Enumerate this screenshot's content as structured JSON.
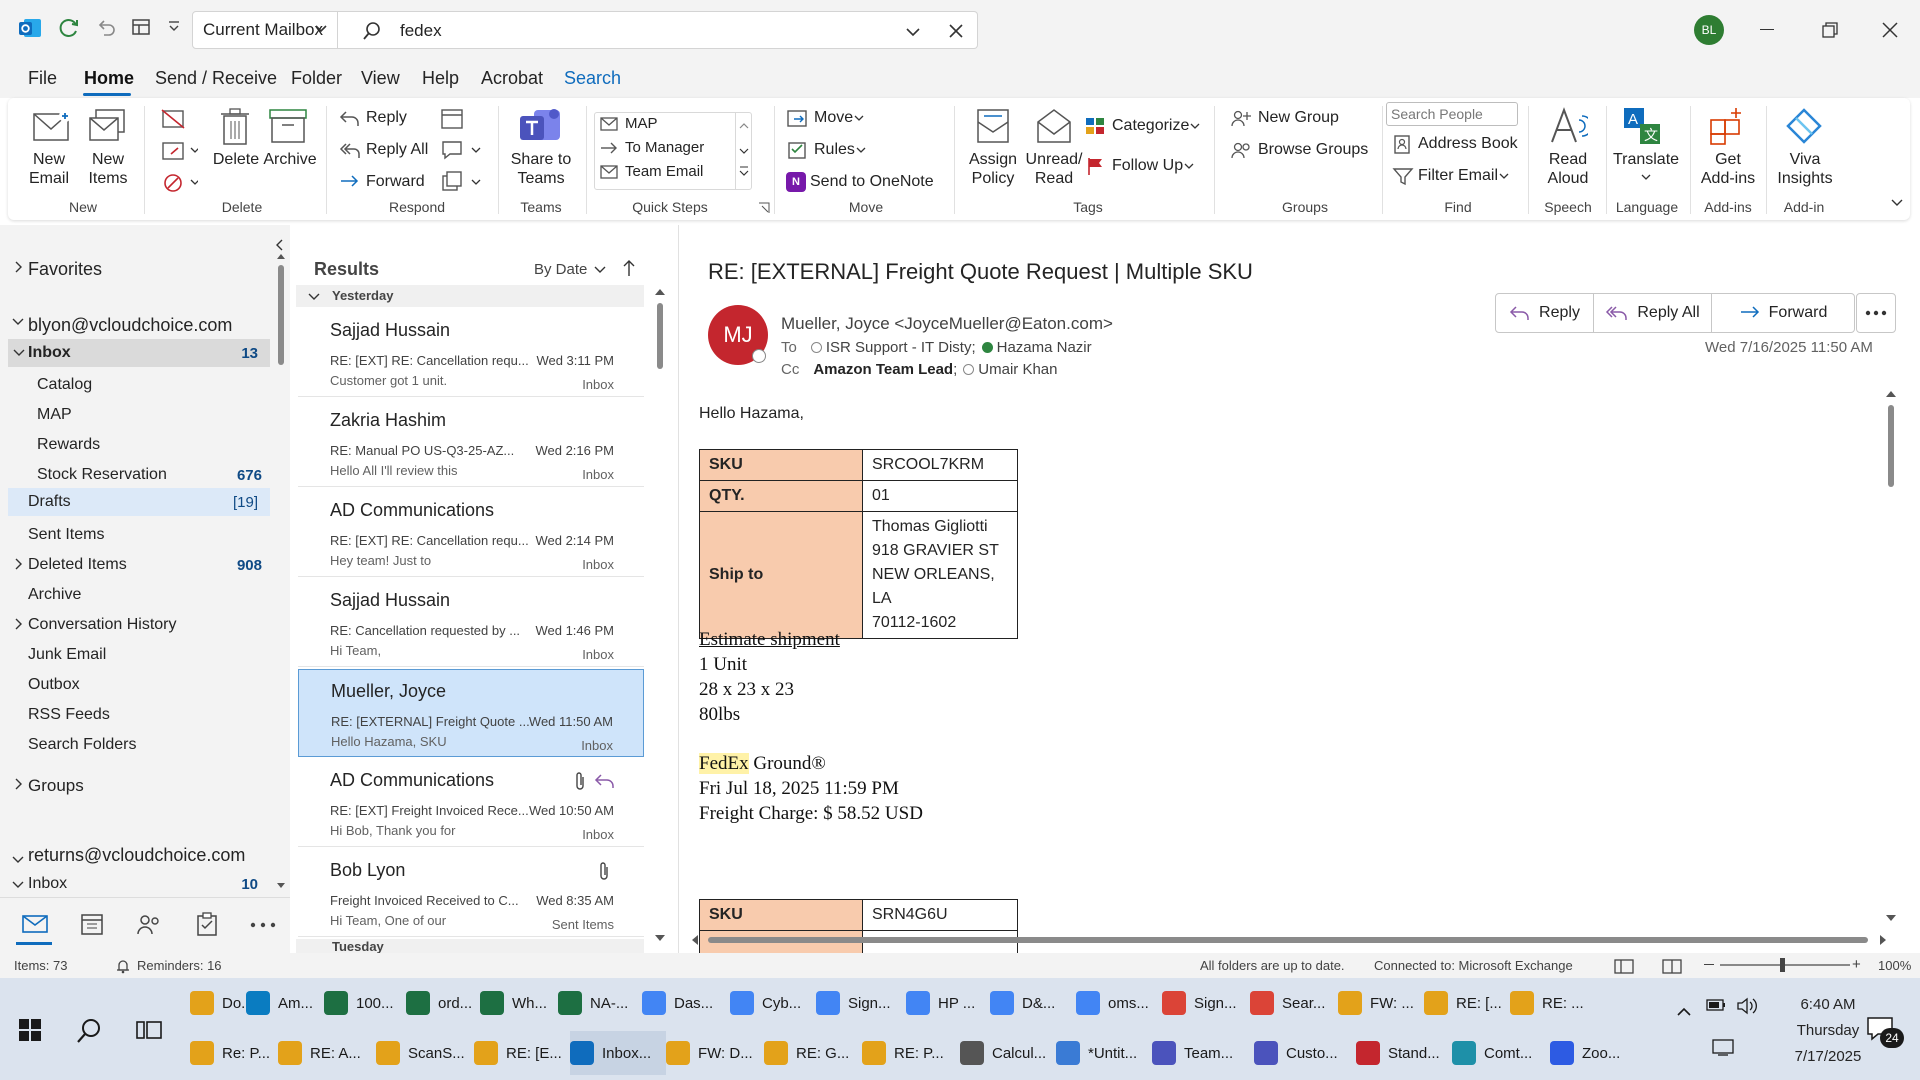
{
  "titlebar": {
    "scope": "Current Mailbox",
    "search_value": "fedex",
    "avatar": "BL"
  },
  "menu": {
    "file": "File",
    "home": "Home",
    "send_receive": "Send / Receive",
    "folder": "Folder",
    "view": "View",
    "help": "Help",
    "acrobat": "Acrobat",
    "search": "Search"
  },
  "ribbon": {
    "new_email": [
      "New",
      "Email"
    ],
    "new_items": [
      "New",
      "Items"
    ],
    "delete": "Delete",
    "archive": "Archive",
    "reply": "Reply",
    "reply_all": "Reply All",
    "forward": "Forward",
    "share_to_teams": [
      "Share to",
      "Teams"
    ],
    "quick_steps": [
      "MAP",
      "To Manager",
      "Team Email"
    ],
    "move": "Move",
    "rules": "Rules",
    "onenote": "Send to OneNote",
    "assign_policy": [
      "Assign",
      "Policy"
    ],
    "unread_read": [
      "Unread/",
      "Read"
    ],
    "categorize": "Categorize",
    "follow_up": "Follow Up",
    "new_group": "New Group",
    "browse_groups": "Browse Groups",
    "search_people": "Search People",
    "address_book": "Address Book",
    "filter_email": "Filter Email",
    "read_aloud": [
      "Read",
      "Aloud"
    ],
    "translate": "Translate",
    "get_addins": [
      "Get",
      "Add-ins"
    ],
    "viva": [
      "Viva",
      "Insights"
    ],
    "groups": {
      "new": "New",
      "delete": "Delete",
      "respond": "Respond",
      "teams": "Teams",
      "quick_steps": "Quick Steps",
      "move": "Move",
      "tags": "Tags",
      "groups": "Groups",
      "find": "Find",
      "speech": "Speech",
      "language": "Language",
      "addins": "Add-ins",
      "addin": "Add-in"
    }
  },
  "nav": {
    "favorites": "Favorites",
    "account1": "blyon@vcloudchoice.com",
    "folders": [
      {
        "label": "Inbox",
        "count": "13"
      },
      {
        "label": "Catalog",
        "count": ""
      },
      {
        "label": "MAP",
        "count": ""
      },
      {
        "label": "Rewards",
        "count": ""
      },
      {
        "label": "Stock Reservation",
        "count": "676"
      },
      {
        "label": "Drafts",
        "count": "[19]"
      },
      {
        "label": "Sent Items",
        "count": ""
      },
      {
        "label": "Deleted Items",
        "count": "908"
      },
      {
        "label": "Archive",
        "count": ""
      },
      {
        "label": "Conversation History",
        "count": ""
      },
      {
        "label": "Junk Email",
        "count": ""
      },
      {
        "label": "Outbox",
        "count": ""
      },
      {
        "label": "RSS Feeds",
        "count": ""
      },
      {
        "label": "Search Folders",
        "count": ""
      }
    ],
    "groups": "Groups",
    "account2": "returns@vcloudchoice.com",
    "inbox2": {
      "label": "Inbox",
      "count": "10"
    }
  },
  "list": {
    "header": "Results",
    "sort": "By Date",
    "group_yesterday": "Yesterday",
    "group_tuesday": "Tuesday",
    "messages": [
      {
        "from": "Sajjad Hussain",
        "subject": "RE: [EXT] RE: Cancellation requ...",
        "time": "Wed 3:11 PM",
        "preview": "Customer got 1 unit.",
        "folder": "Inbox"
      },
      {
        "from": "Zakria Hashim",
        "subject": "RE: Manual PO   US-Q3-25-AZ...",
        "time": "Wed 2:16 PM",
        "preview": "Hello All  I'll review this",
        "folder": "Inbox"
      },
      {
        "from": "AD Communications",
        "subject": "RE: [EXT] RE: Cancellation requ...",
        "time": "Wed 2:14 PM",
        "preview": "Hey team!  Just to",
        "folder": "Inbox"
      },
      {
        "from": "Sajjad Hussain",
        "subject": "RE: Cancellation requested by ...",
        "time": "Wed 1:46 PM",
        "preview": "Hi Team,",
        "folder": "Inbox"
      },
      {
        "from": "Mueller, Joyce",
        "subject": "RE: [EXTERNAL] Freight Quote ...",
        "time": "Wed 11:50 AM",
        "preview": "Hello Hazama,  SKU",
        "folder": "Inbox"
      },
      {
        "from": "AD Communications",
        "subject": "RE: [EXT] Freight Invoiced Rece...",
        "time": "Wed 10:50 AM",
        "preview": "Hi Bob,   Thank you for",
        "folder": "Inbox"
      },
      {
        "from": "Bob Lyon",
        "subject": "Freight Invoiced Received to C...",
        "time": "Wed 8:35 AM",
        "preview": "Hi Team,   One of our",
        "folder": "Sent Items"
      }
    ]
  },
  "email": {
    "subject": "RE: [EXTERNAL] Freight Quote Request | Multiple SKU",
    "initials": "MJ",
    "sender": "Mueller, Joyce <JoyceMueller@Eaton.com>",
    "to_label": "To",
    "to1": "ISR Support - IT Disty;",
    "to2": "Hazama Nazir",
    "cc_label": "Cc",
    "cc1": "Amazon Team Lead",
    "cc2": "Umair Khan",
    "date": "Wed 7/16/2025 11:50 AM",
    "reply": "Reply",
    "reply_all": "Reply All",
    "forward": "Forward",
    "greeting": "Hello Hazama,",
    "table1": {
      "sku_h": "SKU",
      "sku": "SRCOOL7KRM",
      "qty_h": "QTY.",
      "qty": "01",
      "ship_h": "Ship to",
      "ship": [
        "Thomas Gigliotti",
        "918 GRAVIER ST",
        "NEW ORLEANS, LA",
        "70112-1602"
      ]
    },
    "estimate_title": "Estimate shipment",
    "estimate_lines": [
      "1 Unit",
      "28 x 23 x 23",
      "80lbs"
    ],
    "carrier_highlight": "FedEx",
    "carrier_rest": " Ground®",
    "delivery": "Fri Jul 18, 2025 11:59 PM",
    "charge": "Freight Charge: $ 58.52 USD",
    "table2": {
      "sku_h": "SKU",
      "sku": "SRN4G6U"
    }
  },
  "status": {
    "items": "Items: 73",
    "reminders": "Reminders: 16",
    "sync": "All folders are up to date.",
    "connected": "Connected to: Microsoft Exchange",
    "zoom": "100%"
  },
  "taskbar": {
    "row1": [
      "Do...",
      "Am...",
      "100...",
      "ord...",
      "Wh...",
      "NA-...",
      "Das...",
      "Cyb...",
      "Sign...",
      "HP ...",
      "D&...",
      "oms...",
      "Sign...",
      "Sear...",
      "FW: ...",
      "RE: [...",
      "RE: ..."
    ],
    "row2": [
      "Re: P...",
      "RE: A...",
      "ScanS...",
      "RE: [E...",
      "Inbox...",
      "FW: D...",
      "RE: G...",
      "RE: P...",
      "Calcul...",
      "*Untit...",
      "Team...",
      "Custo...",
      "Stand...",
      "Comt...",
      "Zoo..."
    ],
    "time": "6:40 AM",
    "day": "Thursday",
    "date": "7/17/2025",
    "notif": "24"
  },
  "colors": {
    "accent": "#0f6cbd",
    "selected": "#cfe4fa",
    "header_cell": "#f8cbad",
    "avatar": "#c4262e",
    "highlight": "#fff2a8"
  }
}
